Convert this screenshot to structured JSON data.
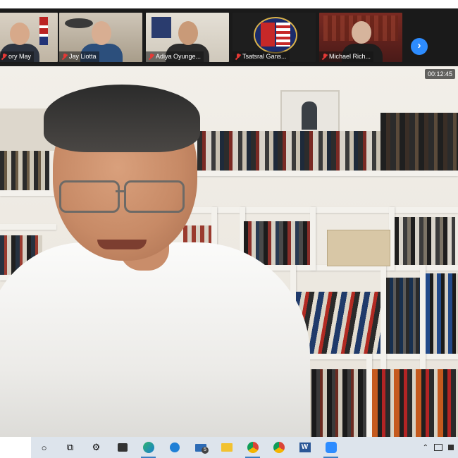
{
  "meeting": {
    "timer": "00:12:45",
    "participants": [
      {
        "name": "Gregory May",
        "display": "ory May",
        "muted": true
      },
      {
        "name": "Jay Liotta",
        "display": "Jay Liotta",
        "muted": true
      },
      {
        "name": "Adiya Oyunge...",
        "display": "Adiya Oyunge...",
        "muted": true
      },
      {
        "name": "Tsatsral Gans...",
        "display": "Tsatsral Gans...",
        "muted": true
      },
      {
        "name": "Michael Rich...",
        "display": "Michael Rich...",
        "muted": true
      }
    ],
    "next_page_glyph": "›"
  },
  "taskbar": {
    "items": [
      {
        "icon": "cortana-circle-icon",
        "glyph": "○"
      },
      {
        "icon": "task-view-icon",
        "glyph": "⧉"
      },
      {
        "icon": "settings-gear-icon",
        "glyph": "⚙"
      },
      {
        "icon": "store-bag-icon",
        "glyph": "🛍"
      },
      {
        "icon": "edge-browser-icon",
        "glyph": "e"
      },
      {
        "icon": "teamviewer-icon",
        "glyph": "⇄"
      },
      {
        "icon": "mail-icon",
        "glyph": "✉",
        "badge": "5"
      },
      {
        "icon": "file-explorer-icon",
        "glyph": "📁"
      },
      {
        "icon": "chrome-icon-1",
        "glyph": "◉"
      },
      {
        "icon": "chrome-icon-2",
        "glyph": "◉"
      },
      {
        "icon": "word-icon",
        "glyph": "W"
      },
      {
        "icon": "zoom-icon",
        "glyph": "▶"
      }
    ],
    "tray": {
      "lang": "^",
      "chevron": "⌃"
    }
  },
  "colors": {
    "zoom_blue": "#2d8cff",
    "muted_red": "#e53935",
    "taskbar": "#dde4ec"
  }
}
